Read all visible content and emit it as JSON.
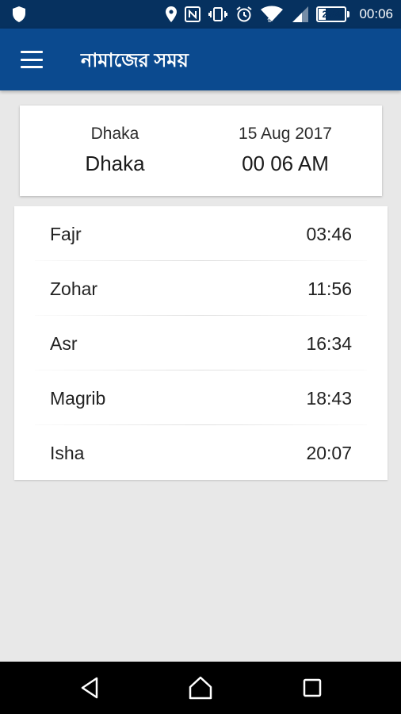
{
  "status_bar": {
    "battery_percent": "25%",
    "battery_level": 0.25,
    "time": "00:06",
    "icons": [
      "shield-icon",
      "location-icon",
      "nfc-icon",
      "vibrate-icon",
      "alarm-icon",
      "wifi-icon",
      "signal-icon",
      "battery-icon"
    ]
  },
  "app_bar": {
    "title": "নামাজের সময়",
    "menu_icon": "hamburger-menu-icon"
  },
  "info": {
    "location_label": "Dhaka",
    "location_value": "Dhaka",
    "date": "15 Aug 2017",
    "current_time": "00 06 AM"
  },
  "prayers": [
    {
      "name": "Fajr",
      "time": "03:46"
    },
    {
      "name": "Zohar",
      "time": "11:56"
    },
    {
      "name": "Asr",
      "time": "16:34"
    },
    {
      "name": "Magrib",
      "time": "18:43"
    },
    {
      "name": "Isha",
      "time": "20:07"
    }
  ],
  "nav_bar": {
    "icons": [
      "back-icon",
      "home-icon",
      "recents-icon"
    ]
  },
  "colors": {
    "status_bar": "#06315f",
    "app_bar": "#0b4a8f",
    "background": "#e8e8e8",
    "card": "#ffffff"
  }
}
